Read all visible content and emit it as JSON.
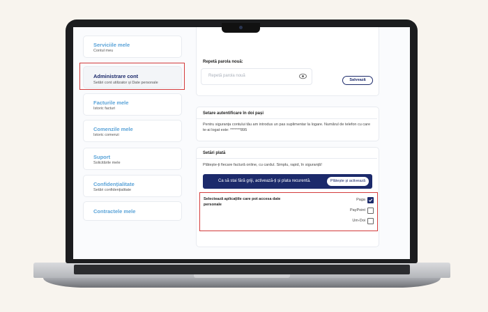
{
  "sidebar": {
    "items": [
      {
        "title": "Serviciile mele",
        "subtitle": "Contul meu"
      },
      {
        "title": "Administrare cont",
        "subtitle": "Setări cont utilizator și Date personale"
      },
      {
        "title": "Facturile mele",
        "subtitle": "Istoric facturi"
      },
      {
        "title": "Comenzile mele",
        "subtitle": "Istoric comenzi"
      },
      {
        "title": "Suport",
        "subtitle": "Solicitările mele"
      },
      {
        "title": "Confidențialitate",
        "subtitle": "Setări confidențialitate"
      },
      {
        "title": "Contractele mele",
        "subtitle": ""
      }
    ]
  },
  "password": {
    "repeat_label": "Repetă parola nouă:",
    "repeat_placeholder": "Repetă parola nouă",
    "save_label": "Salvează"
  },
  "two_factor": {
    "title": "Setare autentificare în doi pași",
    "description": "Pentru siguranța contului tău am introdus un pas suplimentar la logare. Numărul de telefon cu care te-ai logat este: *******895"
  },
  "payment": {
    "title": "Setări plată",
    "description": "Plătește-ți fiecare factură online, cu cardul. Simplu, rapid, în siguranță!",
    "banner_text": "Ca să stai fără griji, activează-ți și plata recurentă.",
    "banner_button": "Plătește și activează"
  },
  "apps": {
    "title": "Selectează aplicațiile care pot accesa date personale",
    "items": [
      {
        "label": "Paga",
        "checked": true
      },
      {
        "label": "PayPoint",
        "checked": false
      },
      {
        "label": "Um-Doi",
        "checked": false
      }
    ]
  }
}
